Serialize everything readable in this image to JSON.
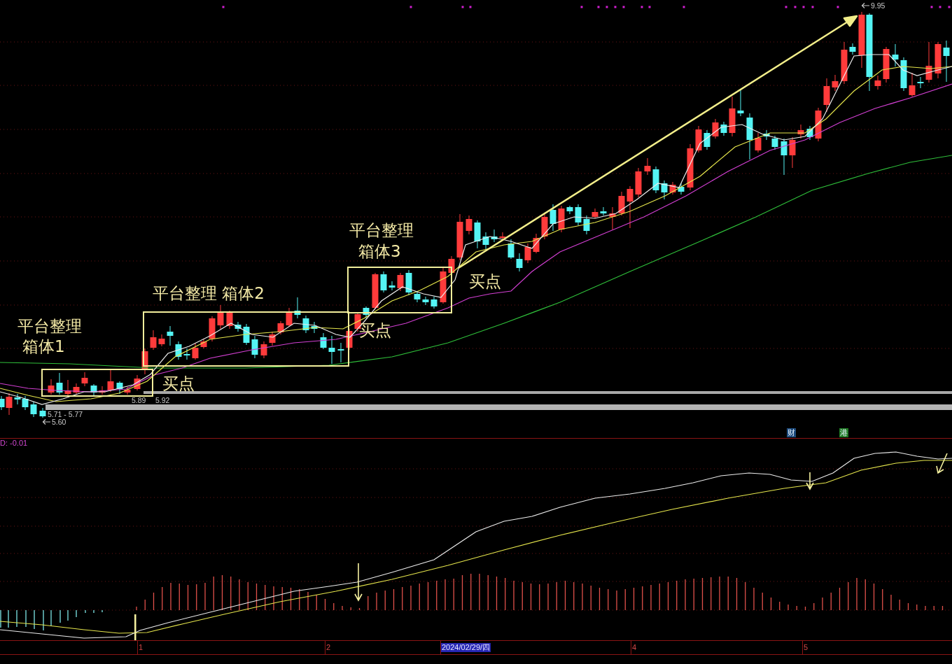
{
  "main_chart": {
    "annotations": [
      {
        "lines": [
          "平台整理",
          "箱体1"
        ]
      },
      {
        "lines": [
          "平台整理 箱体2"
        ]
      },
      {
        "lines": [
          "平台整理",
          "箱体3"
        ]
      }
    ],
    "buy_points": [
      "买点",
      "买点",
      "买点"
    ],
    "price_labels": [
      {
        "kind": "range",
        "text": "5.89"
      },
      {
        "kind": "range",
        "text": "5.92"
      },
      {
        "kind": "range",
        "text": "5.71 - 5.77"
      },
      {
        "kind": "pointer",
        "text": "5.60"
      },
      {
        "kind": "pointer",
        "text": "9.95"
      }
    ],
    "badges": [
      {
        "text": "财",
        "color": "#1c4a7c"
      },
      {
        "text": "港",
        "color": "#1f7a24"
      }
    ]
  },
  "indicator": {
    "label": "D: -0.01"
  },
  "time_axis": {
    "ticks": [
      {
        "label": "1",
        "selected": false
      },
      {
        "label": "2",
        "selected": false
      },
      {
        "label": "2024/02/29/四",
        "selected": true
      },
      {
        "label": "4",
        "selected": false
      },
      {
        "label": "5",
        "selected": false
      }
    ]
  }
}
